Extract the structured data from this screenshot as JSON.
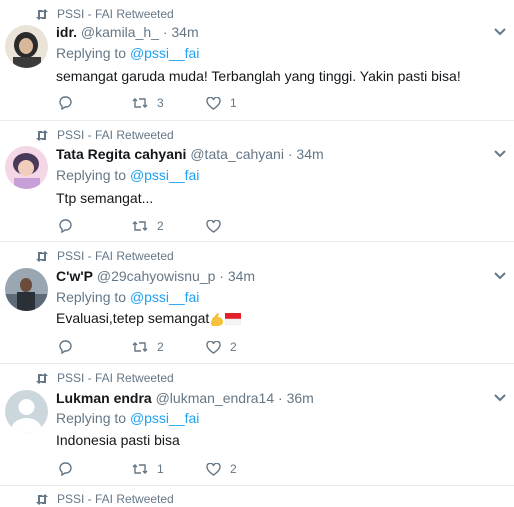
{
  "colors": {
    "accent": "#1da1f2",
    "muted": "#657786",
    "text": "#14171a",
    "divider": "#e6ecf0"
  },
  "tweets": [
    {
      "retweet_label": "PSSI - FAI Retweeted",
      "name": "idr.",
      "handle": "@kamila_h_",
      "time": "34m",
      "replying_prefix": "Replying to",
      "replying_to": "@pssi__fai",
      "text": "semangat garuda muda! Terbanglah yang tinggi. Yakin pasti bisa!",
      "reply_count": "",
      "retweet_count": "3",
      "like_count": "1"
    },
    {
      "retweet_label": "PSSI - FAI Retweeted",
      "name": "Tata Regita cahyani",
      "handle": "@tata_cahyani",
      "time": "34m",
      "replying_prefix": "Replying to",
      "replying_to": "@pssi__fai",
      "text": "Ttp semangat...",
      "reply_count": "",
      "retweet_count": "2",
      "like_count": ""
    },
    {
      "retweet_label": "PSSI - FAI Retweeted",
      "name": "C'w'P",
      "handle": "@29cahyowisnu_p",
      "time": "34m",
      "replying_prefix": "Replying to",
      "replying_to": "@pssi__fai",
      "text": "Evaluasi,tetep semangat",
      "emojis": [
        "flexed-biceps",
        "indonesia-flag"
      ],
      "reply_count": "",
      "retweet_count": "2",
      "like_count": "2"
    },
    {
      "retweet_label": "PSSI - FAI Retweeted",
      "name": "Lukman endra",
      "handle": "@lukman_endra14",
      "time": "36m",
      "replying_prefix": "Replying to",
      "replying_to": "@pssi__fai",
      "text": "Indonesia pasti bisa",
      "reply_count": "",
      "retweet_count": "1",
      "like_count": "2"
    },
    {
      "retweet_label": "PSSI - FAI Retweeted"
    }
  ]
}
